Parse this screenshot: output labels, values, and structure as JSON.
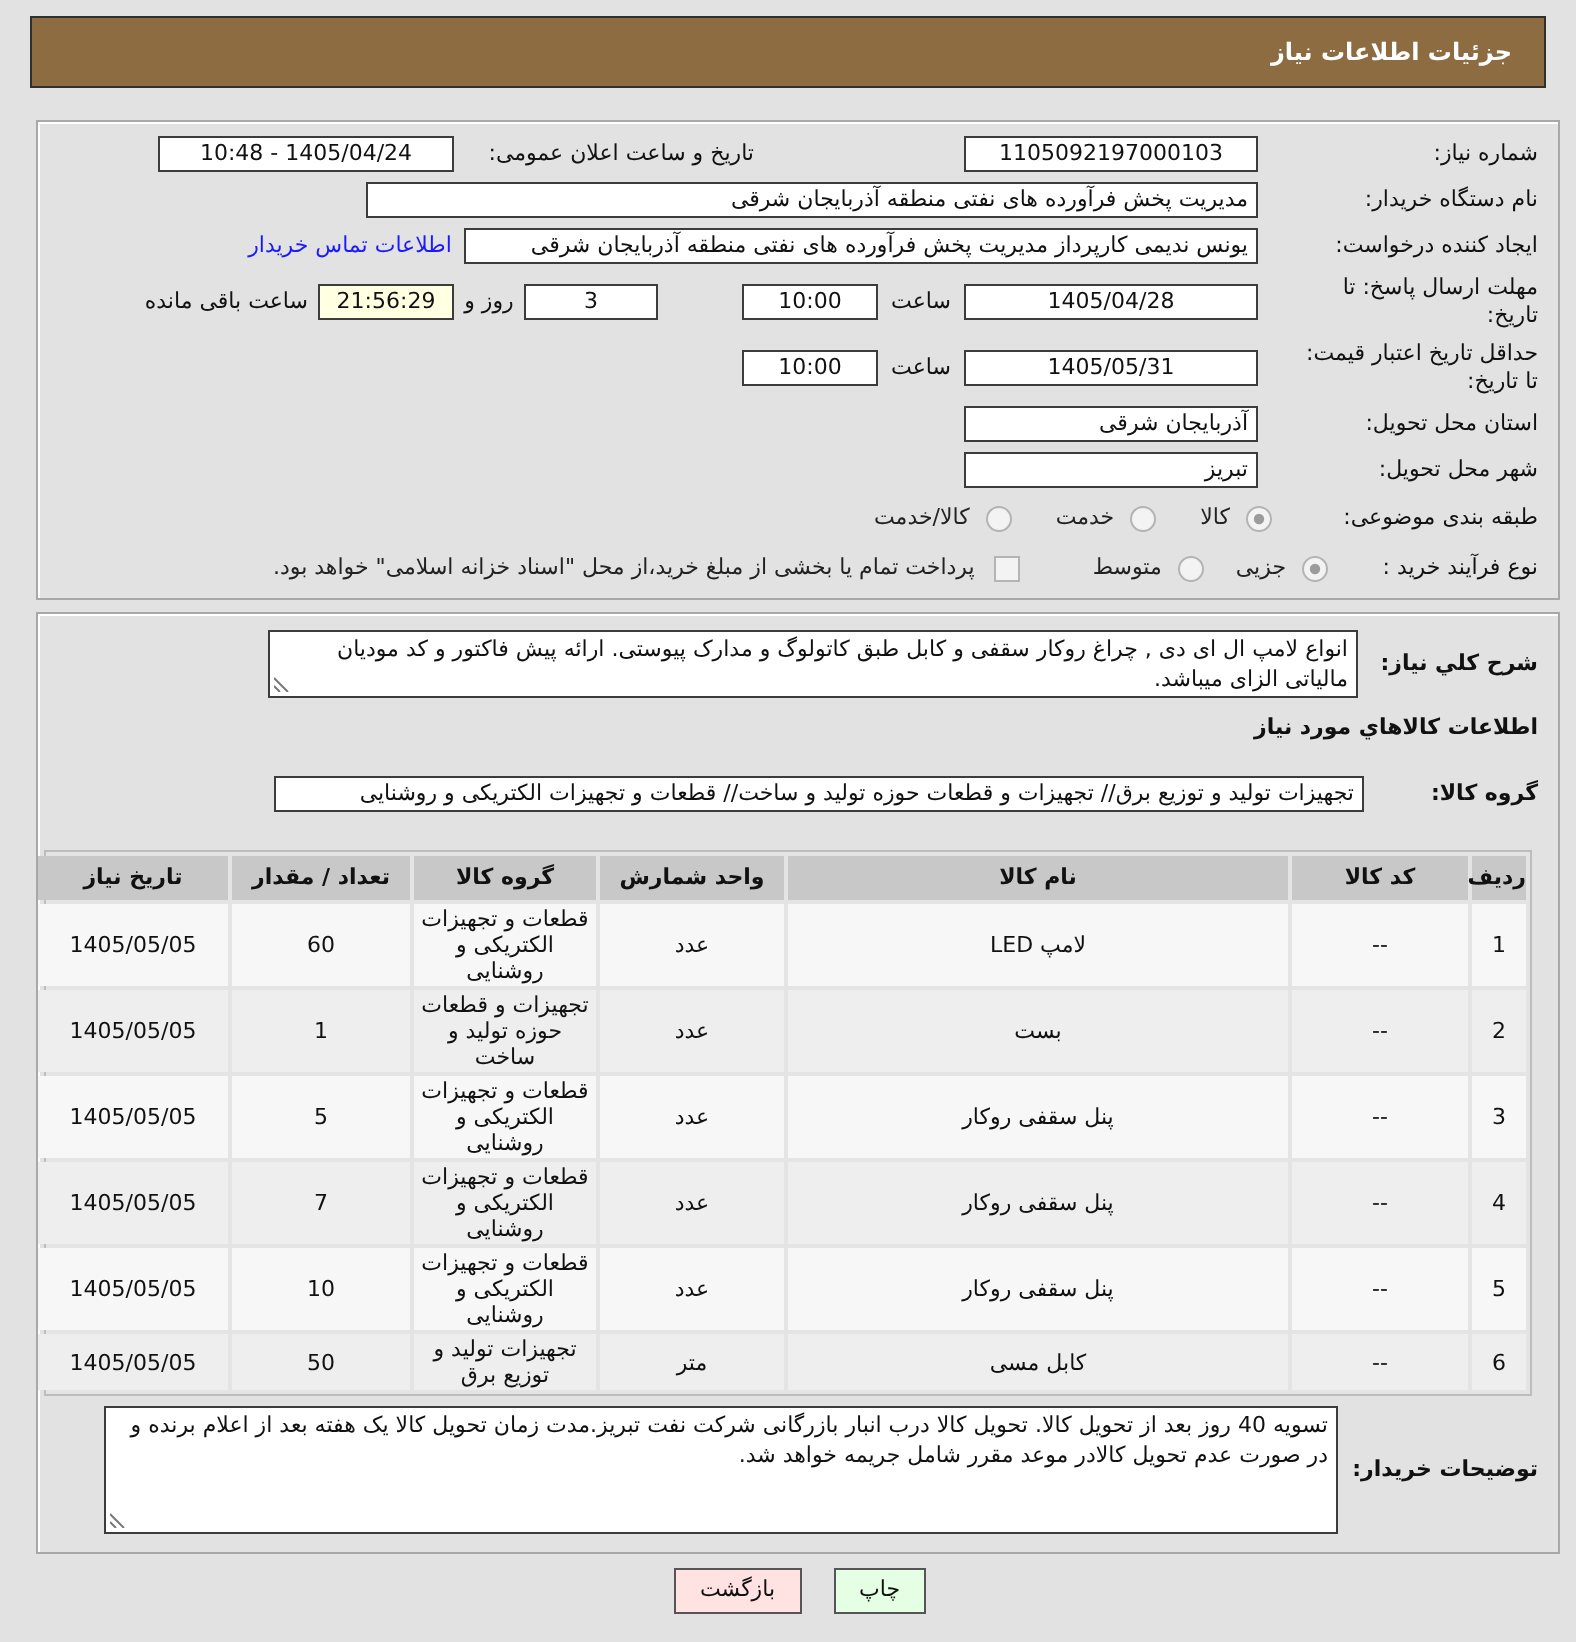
{
  "header": {
    "title": "جزئیات اطلاعات نیاز"
  },
  "details": {
    "need_number": {
      "label": "شماره نیاز:",
      "value": "1105092197000103"
    },
    "announce": {
      "label": "تاریخ و ساعت اعلان عمومی:",
      "value": "1405/04/24 - 10:48"
    },
    "buyer_org": {
      "label": "نام دستگاه خریدار:",
      "value": "مدیریت پخش فرآورده های نفتی منطقه آذربایجان شرقی"
    },
    "creator": {
      "label": "ایجاد کننده درخواست:",
      "value": "یونس ندیمی کارپرداز مدیریت پخش فرآورده های نفتی منطقه آذربایجان شرقی",
      "link": "اطلاعات تماس خریدار"
    },
    "deadline": {
      "label": "مهلت ارسال پاسخ: تا تاریخ:",
      "date": "1405/04/28",
      "time_label": "ساعت",
      "time": "10:00",
      "days": "3",
      "days_label": "روز و",
      "remaining": "21:56:29",
      "remaining_label": "ساعت باقی مانده"
    },
    "price_validity": {
      "label": "حداقل تاریخ اعتبار قیمت: تا تاریخ:",
      "date": "1405/05/31",
      "time_label": "ساعت",
      "time": "10:00"
    },
    "province": {
      "label": "استان محل تحویل:",
      "value": "آذربایجان شرقی"
    },
    "city": {
      "label": "شهر محل تحویل:",
      "value": "تبریز"
    },
    "category": {
      "label": "طبقه بندی موضوعی:",
      "options": [
        {
          "label": "کالا",
          "selected": true
        },
        {
          "label": "خدمت",
          "selected": false
        },
        {
          "label": "کالا/خدمت",
          "selected": false
        }
      ]
    },
    "process": {
      "label": "نوع فرآیند خرید :",
      "options": [
        {
          "label": "جزیی",
          "selected": true
        },
        {
          "label": "متوسط",
          "selected": false
        }
      ],
      "treasury": {
        "label": "پرداخت تمام یا بخشی از مبلغ خرید،از محل \"اسناد خزانه اسلامی\" خواهد بود.",
        "checked": false
      }
    }
  },
  "needs": {
    "description": {
      "label": "شرح کلي نیاز:",
      "value": "انواع لامپ ال ای دی , چراغ روکار سقفی و کابل طبق کاتولوگ و مدارک پیوستی. ارائه پیش فاکتور و کد مودیان مالیاتی الزای میباشد."
    },
    "items_title": "اطلاعات کالاهاي مورد نیاز",
    "goods_group": {
      "label": "گروه کالا:",
      "value": "تجهیزات تولید و توزیع برق// تجهیزات و قطعات حوزه تولید و ساخت// قطعات و تجهیزات الکتریکی و روشنایی"
    },
    "table": {
      "columns": [
        "ردیف",
        "کد کالا",
        "نام کالا",
        "واحد شمارش",
        "گروه کالا",
        "تعداد / مقدار",
        "تاریخ نیاز"
      ],
      "rows": [
        [
          "1",
          "--",
          "لامپ LED",
          "عدد",
          "قطعات و تجهیزات الکتریکی و روشنایی",
          "60",
          "1405/05/05"
        ],
        [
          "2",
          "--",
          "بست",
          "عدد",
          "تجهیزات و قطعات حوزه تولید و ساخت",
          "1",
          "1405/05/05"
        ],
        [
          "3",
          "--",
          "پنل سقفی روکار",
          "عدد",
          "قطعات و تجهیزات الکتریکی و روشنایی",
          "5",
          "1405/05/05"
        ],
        [
          "4",
          "--",
          "پنل سقفی روکار",
          "عدد",
          "قطعات و تجهیزات الکتریکی و روشنایی",
          "7",
          "1405/05/05"
        ],
        [
          "5",
          "--",
          "پنل سقفی روکار",
          "عدد",
          "قطعات و تجهیزات الکتریکی و روشنایی",
          "10",
          "1405/05/05"
        ],
        [
          "6",
          "--",
          "کابل مسی",
          "متر",
          "تجهیزات تولید و توزیع برق",
          "50",
          "1405/05/05"
        ]
      ]
    },
    "buyer_notes": {
      "label": "توضیحات خریدار:",
      "value": "تسویه 40 روز بعد از تحویل کالا. تحویل کالا درب انبار بازرگانی شرکت نفت تبریز.مدت زمان تحویل کالا یک هفته بعد از اعلام برنده و در صورت عدم تحویل کالادر موعد مقرر شامل جریمه خواهد شد."
    }
  },
  "buttons": [
    {
      "label": "چاپ",
      "kind": "print"
    },
    {
      "label": "بازگشت",
      "kind": "back"
    }
  ]
}
